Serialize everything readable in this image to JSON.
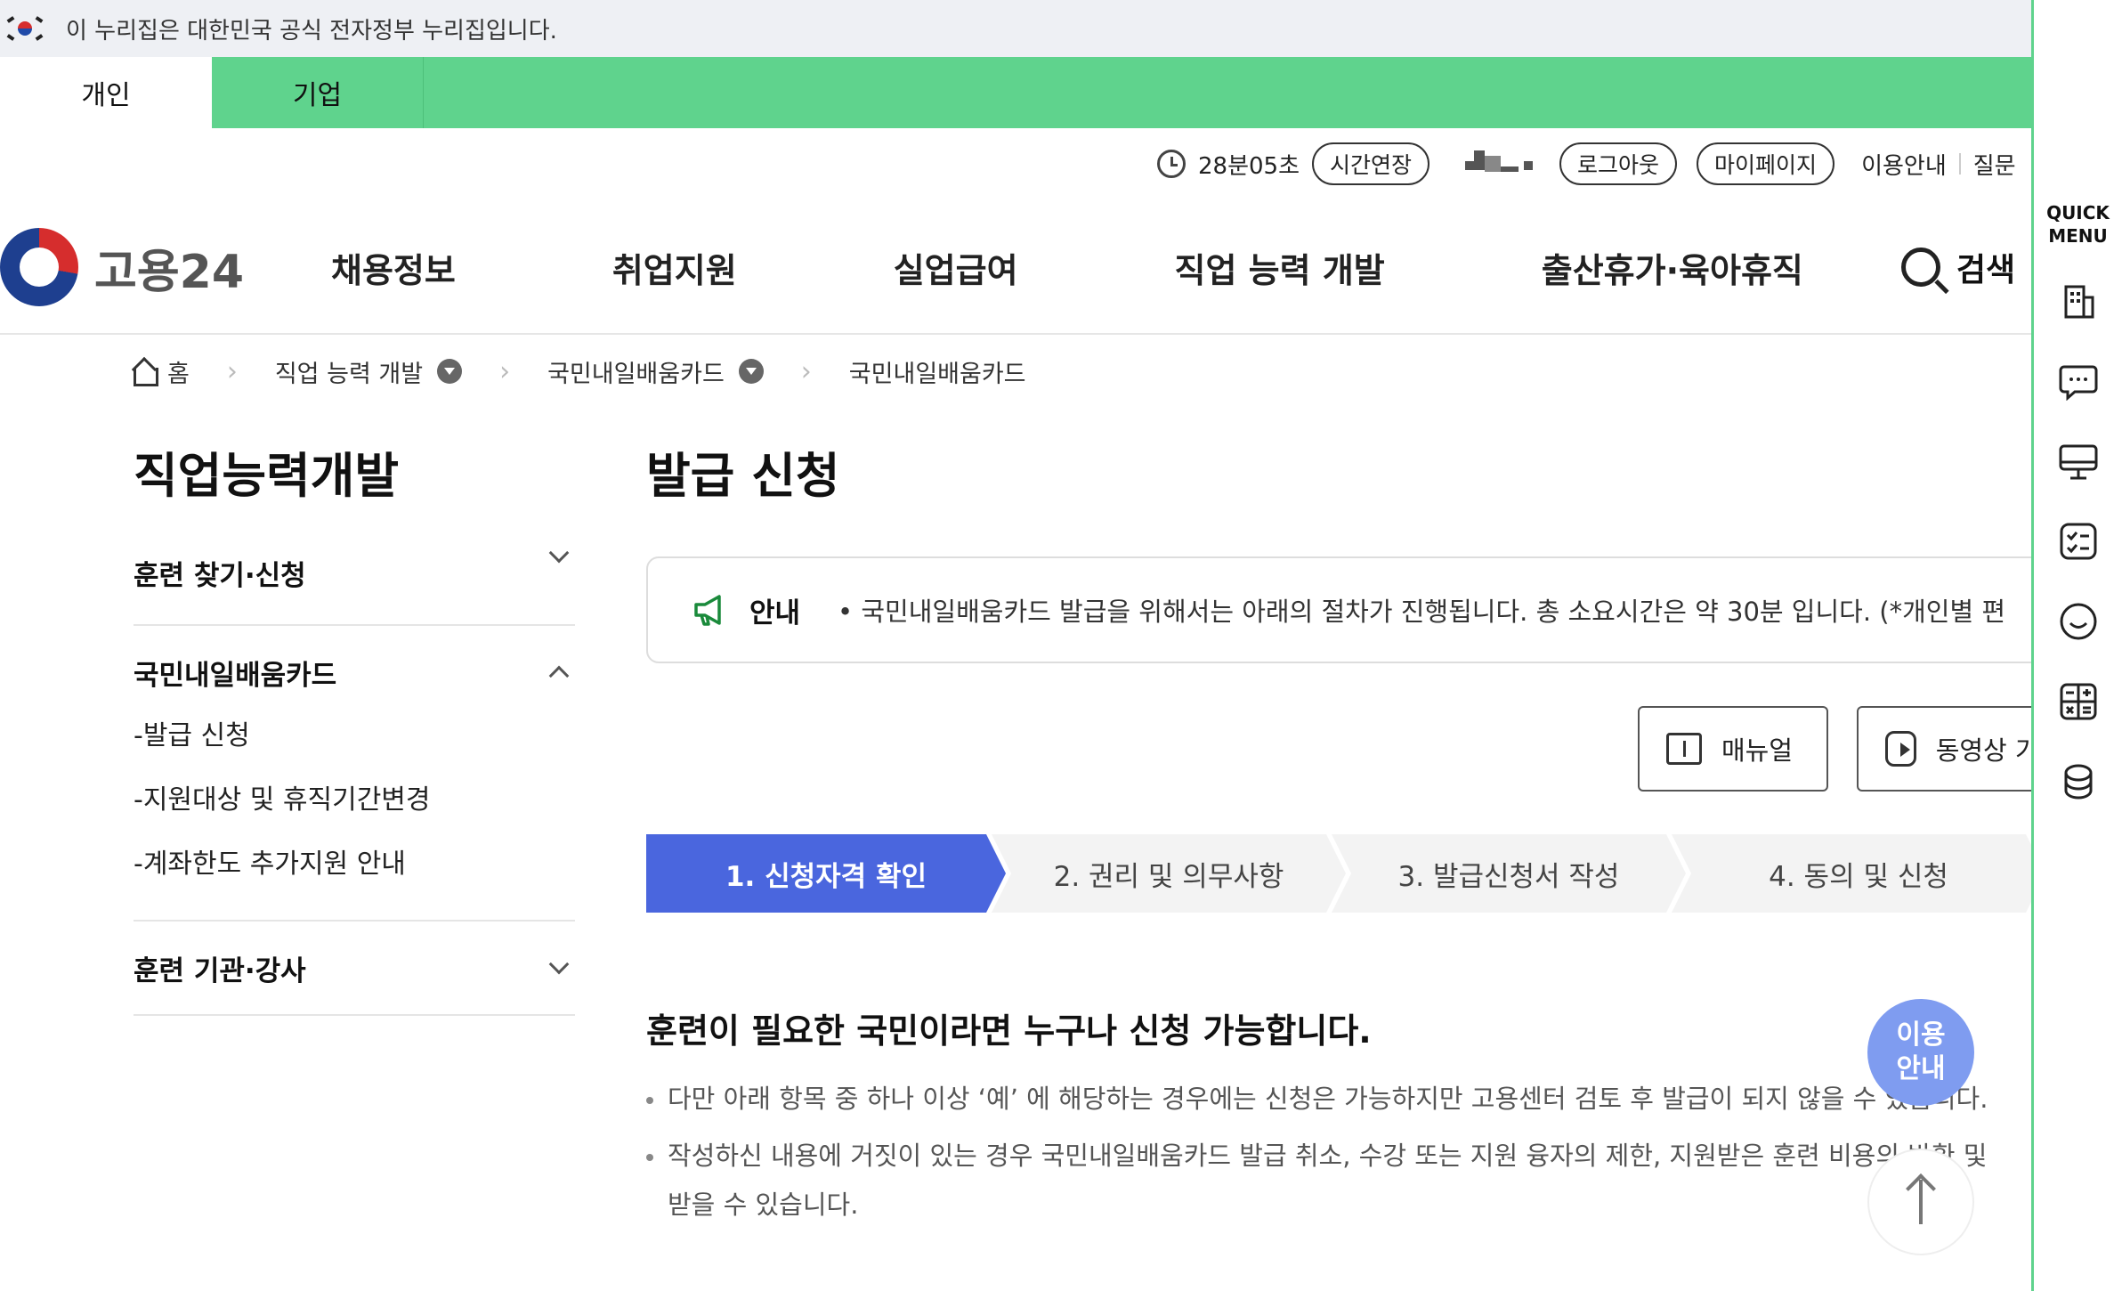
{
  "gov_banner": {
    "text": "이 누리집은 대한민국 공식 전자정부 누리집입니다."
  },
  "user_tabs": [
    {
      "label": "개인"
    },
    {
      "label": "기업"
    }
  ],
  "utility": {
    "timer": "28분05초",
    "extend": "시간연장",
    "logout": "로그아웃",
    "mypage": "마이페이지",
    "guide": "이용안내",
    "faq": "질문"
  },
  "header": {
    "logo_text": "고용24",
    "nav": [
      {
        "label": "채용정보"
      },
      {
        "label": "취업지원"
      },
      {
        "label": "실업급여"
      },
      {
        "label": "직업 능력 개발"
      },
      {
        "label": "출산휴가·육아휴직"
      }
    ],
    "search_label": "검색"
  },
  "breadcrumb": {
    "home": "홈",
    "items": [
      {
        "label": "직업 능력 개발"
      },
      {
        "label": "국민내일배움카드"
      },
      {
        "label": "국민내일배움카드"
      }
    ]
  },
  "sidebar": {
    "title": "직업능력개발",
    "groups": [
      {
        "label": "훈련 찾기·신청"
      },
      {
        "label": "국민내일배움카드",
        "subs": [
          {
            "label": "-발급 신청"
          },
          {
            "label": "-지원대상 및 휴직기간변경"
          },
          {
            "label": "-계좌한도 추가지원 안내"
          }
        ]
      },
      {
        "label": "훈련 기관·강사"
      }
    ]
  },
  "content": {
    "title": "발급 신청",
    "notice_label": "안내",
    "notice_text": "• 국민내일배움카드 발급을 위해서는 아래의 절차가 진행됩니다. 총 소요시간은 약 30분 입니다. (*개인별 편",
    "manual_label": "매뉴얼",
    "video_label": "동영상 가이드",
    "steps": [
      {
        "label": "1. 신청자격 확인"
      },
      {
        "label": "2. 권리 및 의무사항"
      },
      {
        "label": "3. 발급신청서 작성"
      },
      {
        "label": "4. 동의 및 신청"
      }
    ],
    "section_title": "훈련이 필요한 국민이라면 누구나 신청 가능합니다.",
    "bullet1": "다만 아래 항목 중 하나 이상 ‘예’ 에 해당하는 경우에는 신청은 가능하지만 고용센터 검토 후 발급이 되지 않을 수 있습니다.",
    "bullet2": "작성하신 내용에 거짓이 있는 경우 국민내일배움카드 발급 취소, 수강 또는 지원 융자의 제한, 지원받은 훈련 비용의 반환 및",
    "bullet2_cont": "받을 수 있습니다."
  },
  "quick_menu": {
    "title_line1": "QUICK",
    "title_line2": "MENU"
  },
  "floating": {
    "guide_line1": "이용",
    "guide_line2": "안내"
  },
  "colors": {
    "green": "#5fd38d",
    "step_active": "#4a66de",
    "float_guide": "#7f9cf0"
  }
}
